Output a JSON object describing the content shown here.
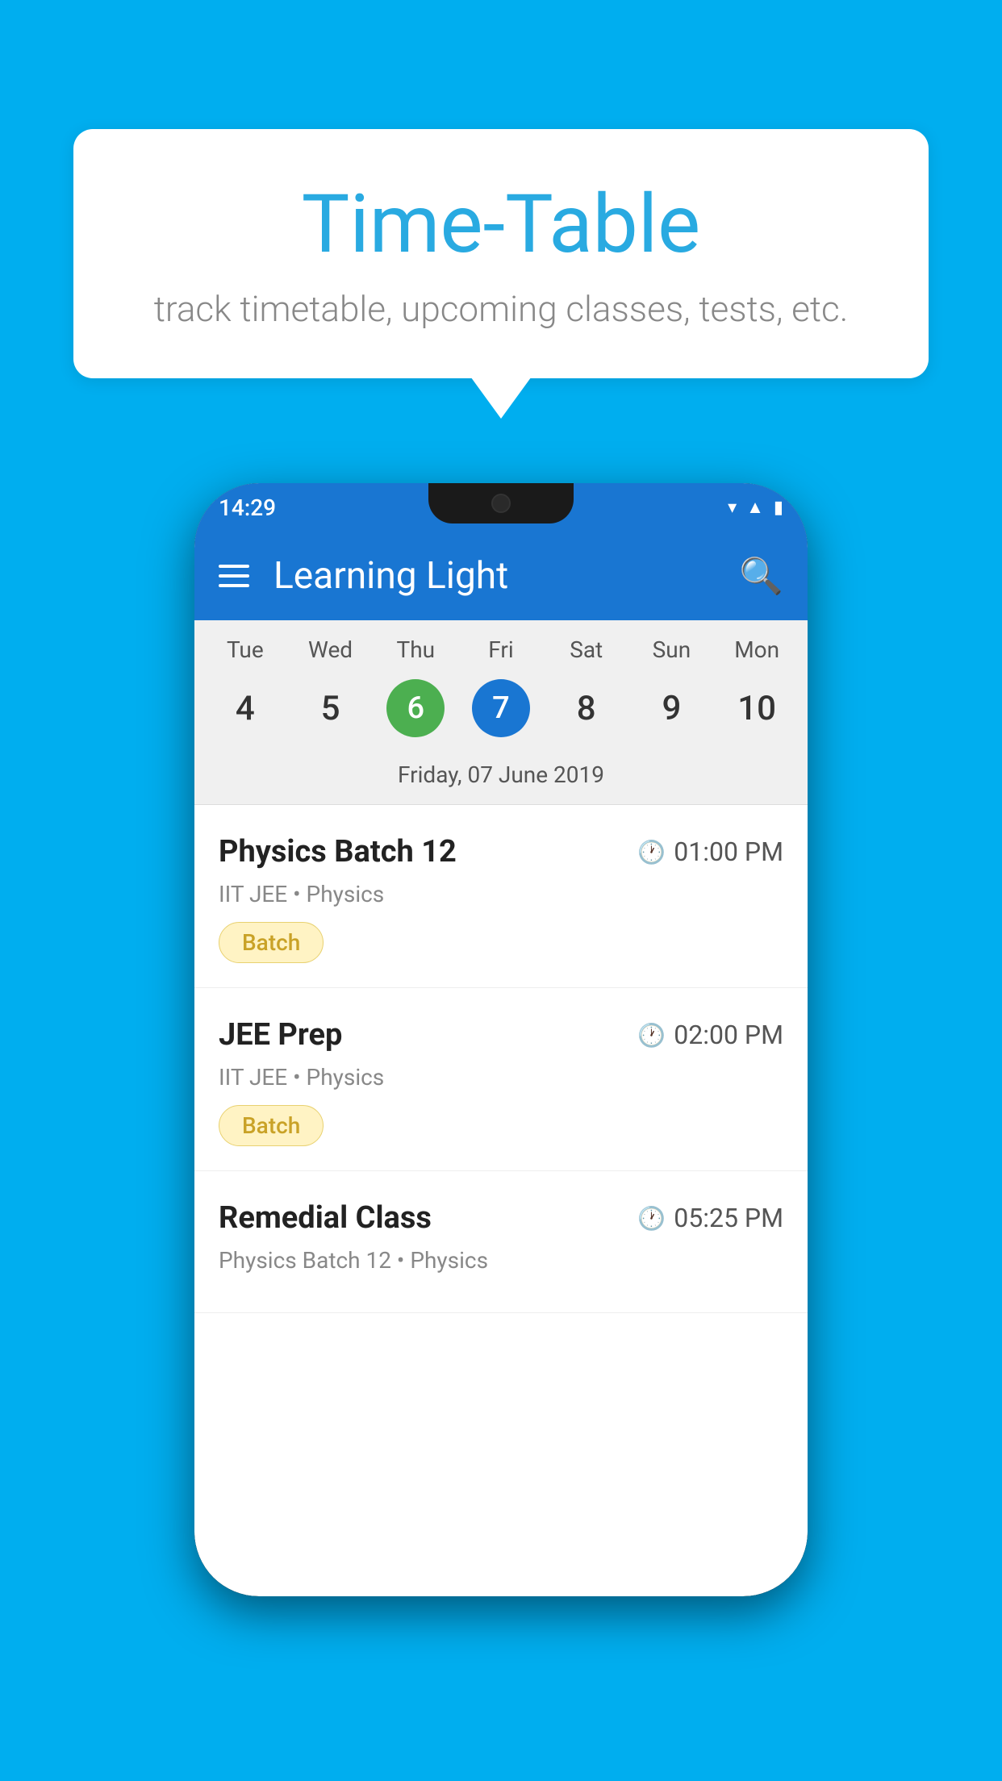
{
  "background_color": "#00AEEF",
  "speech_bubble": {
    "title": "Time-Table",
    "subtitle": "track timetable, upcoming classes, tests, etc."
  },
  "phone": {
    "status_bar": {
      "time": "14:29",
      "icons": [
        "wifi",
        "signal",
        "battery"
      ]
    },
    "app_bar": {
      "title": "Learning Light",
      "menu_icon": "hamburger",
      "search_icon": "search"
    },
    "calendar": {
      "days": [
        {
          "label": "Tue",
          "number": "4"
        },
        {
          "label": "Wed",
          "number": "5"
        },
        {
          "label": "Thu",
          "number": "6",
          "state": "today"
        },
        {
          "label": "Fri",
          "number": "7",
          "state": "selected"
        },
        {
          "label": "Sat",
          "number": "8"
        },
        {
          "label": "Sun",
          "number": "9"
        },
        {
          "label": "Mon",
          "number": "10"
        }
      ],
      "selected_date": "Friday, 07 June 2019"
    },
    "classes": [
      {
        "name": "Physics Batch 12",
        "time": "01:00 PM",
        "category": "IIT JEE • Physics",
        "badge": "Batch"
      },
      {
        "name": "JEE Prep",
        "time": "02:00 PM",
        "category": "IIT JEE • Physics",
        "badge": "Batch"
      },
      {
        "name": "Remedial Class",
        "time": "05:25 PM",
        "category": "Physics Batch 12 • Physics",
        "badge": ""
      }
    ]
  }
}
